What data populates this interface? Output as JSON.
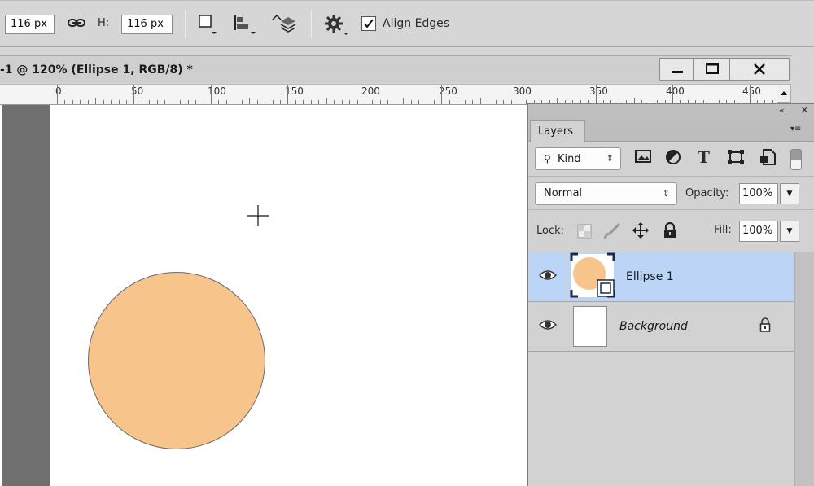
{
  "options_bar": {
    "width_value": "116 px",
    "height_label": "H:",
    "height_value": "116 px",
    "align_edges_label": "Align Edges",
    "align_edges_checked": true
  },
  "document": {
    "title": "-1 @ 120% (Ellipse 1, RGB/8) *",
    "ellipse_color": "#f7c48c"
  },
  "ruler": {
    "labels": [
      "0",
      "50",
      "100",
      "150",
      "200",
      "250",
      "300",
      "350",
      "400",
      "450"
    ]
  },
  "layers_panel": {
    "tab_label": "Layers",
    "filter_kind": "Kind",
    "blend_mode": "Normal",
    "opacity_label": "Opacity:",
    "opacity_value": "100%",
    "lock_label": "Lock:",
    "fill_label": "Fill:",
    "fill_value": "100%",
    "layers": [
      {
        "name": "Ellipse 1",
        "selected": true
      },
      {
        "name": "Background",
        "selected": false,
        "locked": true
      }
    ],
    "selected_color": "#bcd4f6"
  }
}
